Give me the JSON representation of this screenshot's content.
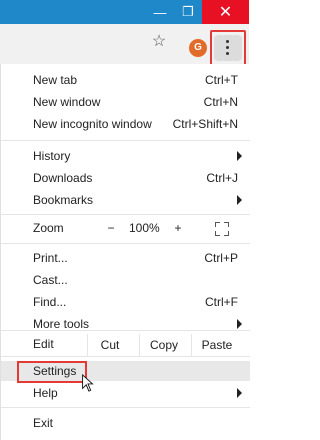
{
  "window": {
    "controls": {
      "minimize": "—",
      "maximize": "❐",
      "close": "✕"
    }
  },
  "toolbar": {
    "avatar_letter": "G",
    "icons": [
      "star-icon",
      "menu-dots-icon"
    ]
  },
  "menu": {
    "new_tab": {
      "label": "New tab",
      "shortcut": "Ctrl+T"
    },
    "new_window": {
      "label": "New window",
      "shortcut": "Ctrl+N"
    },
    "new_incognito": {
      "label": "New incognito window",
      "shortcut": "Ctrl+Shift+N"
    },
    "history": {
      "label": "History"
    },
    "downloads": {
      "label": "Downloads",
      "shortcut": "Ctrl+J"
    },
    "bookmarks": {
      "label": "Bookmarks"
    },
    "zoom": {
      "label": "Zoom",
      "minus": "−",
      "value": "100%",
      "plus": "+"
    },
    "print": {
      "label": "Print...",
      "shortcut": "Ctrl+P"
    },
    "cast": {
      "label": "Cast..."
    },
    "find": {
      "label": "Find...",
      "shortcut": "Ctrl+F"
    },
    "more_tools": {
      "label": "More tools"
    },
    "edit": {
      "label": "Edit",
      "cut": "Cut",
      "copy": "Copy",
      "paste": "Paste"
    },
    "settings": {
      "label": "Settings"
    },
    "help": {
      "label": "Help"
    },
    "exit": {
      "label": "Exit"
    }
  },
  "colors": {
    "titlebar": "#1e88c9",
    "close_button": "#e81123",
    "highlight_border": "#e53935",
    "avatar": "#e36b2a"
  }
}
